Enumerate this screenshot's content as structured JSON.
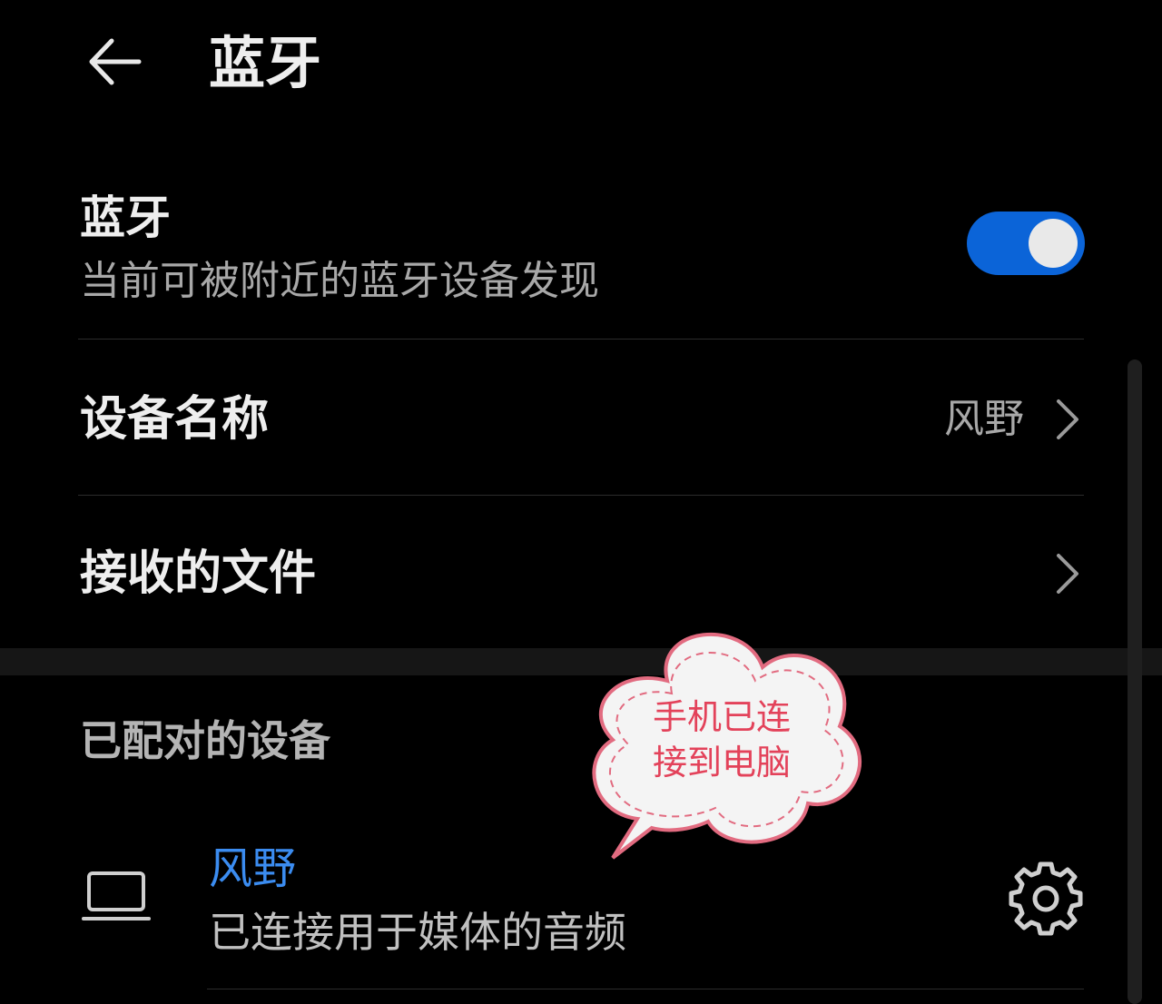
{
  "header": {
    "title": "蓝牙"
  },
  "bluetooth": {
    "label": "蓝牙",
    "subtitle": "当前可被附近的蓝牙设备发现",
    "enabled": true
  },
  "settings": {
    "device_name": {
      "label": "设备名称",
      "value": "风野"
    },
    "received_files": {
      "label": "接收的文件"
    }
  },
  "paired": {
    "section_title": "已配对的设备",
    "devices": [
      {
        "name": "风野",
        "status": "已连接用于媒体的音频",
        "icon": "laptop-icon"
      }
    ]
  },
  "annotation": {
    "line1": "手机已连",
    "line2": "接到电脑"
  },
  "colors": {
    "accent": "#0b64d8",
    "device_name": "#3b8cf0",
    "annotation_text": "#e3425a",
    "annotation_border": "#e26b80"
  }
}
